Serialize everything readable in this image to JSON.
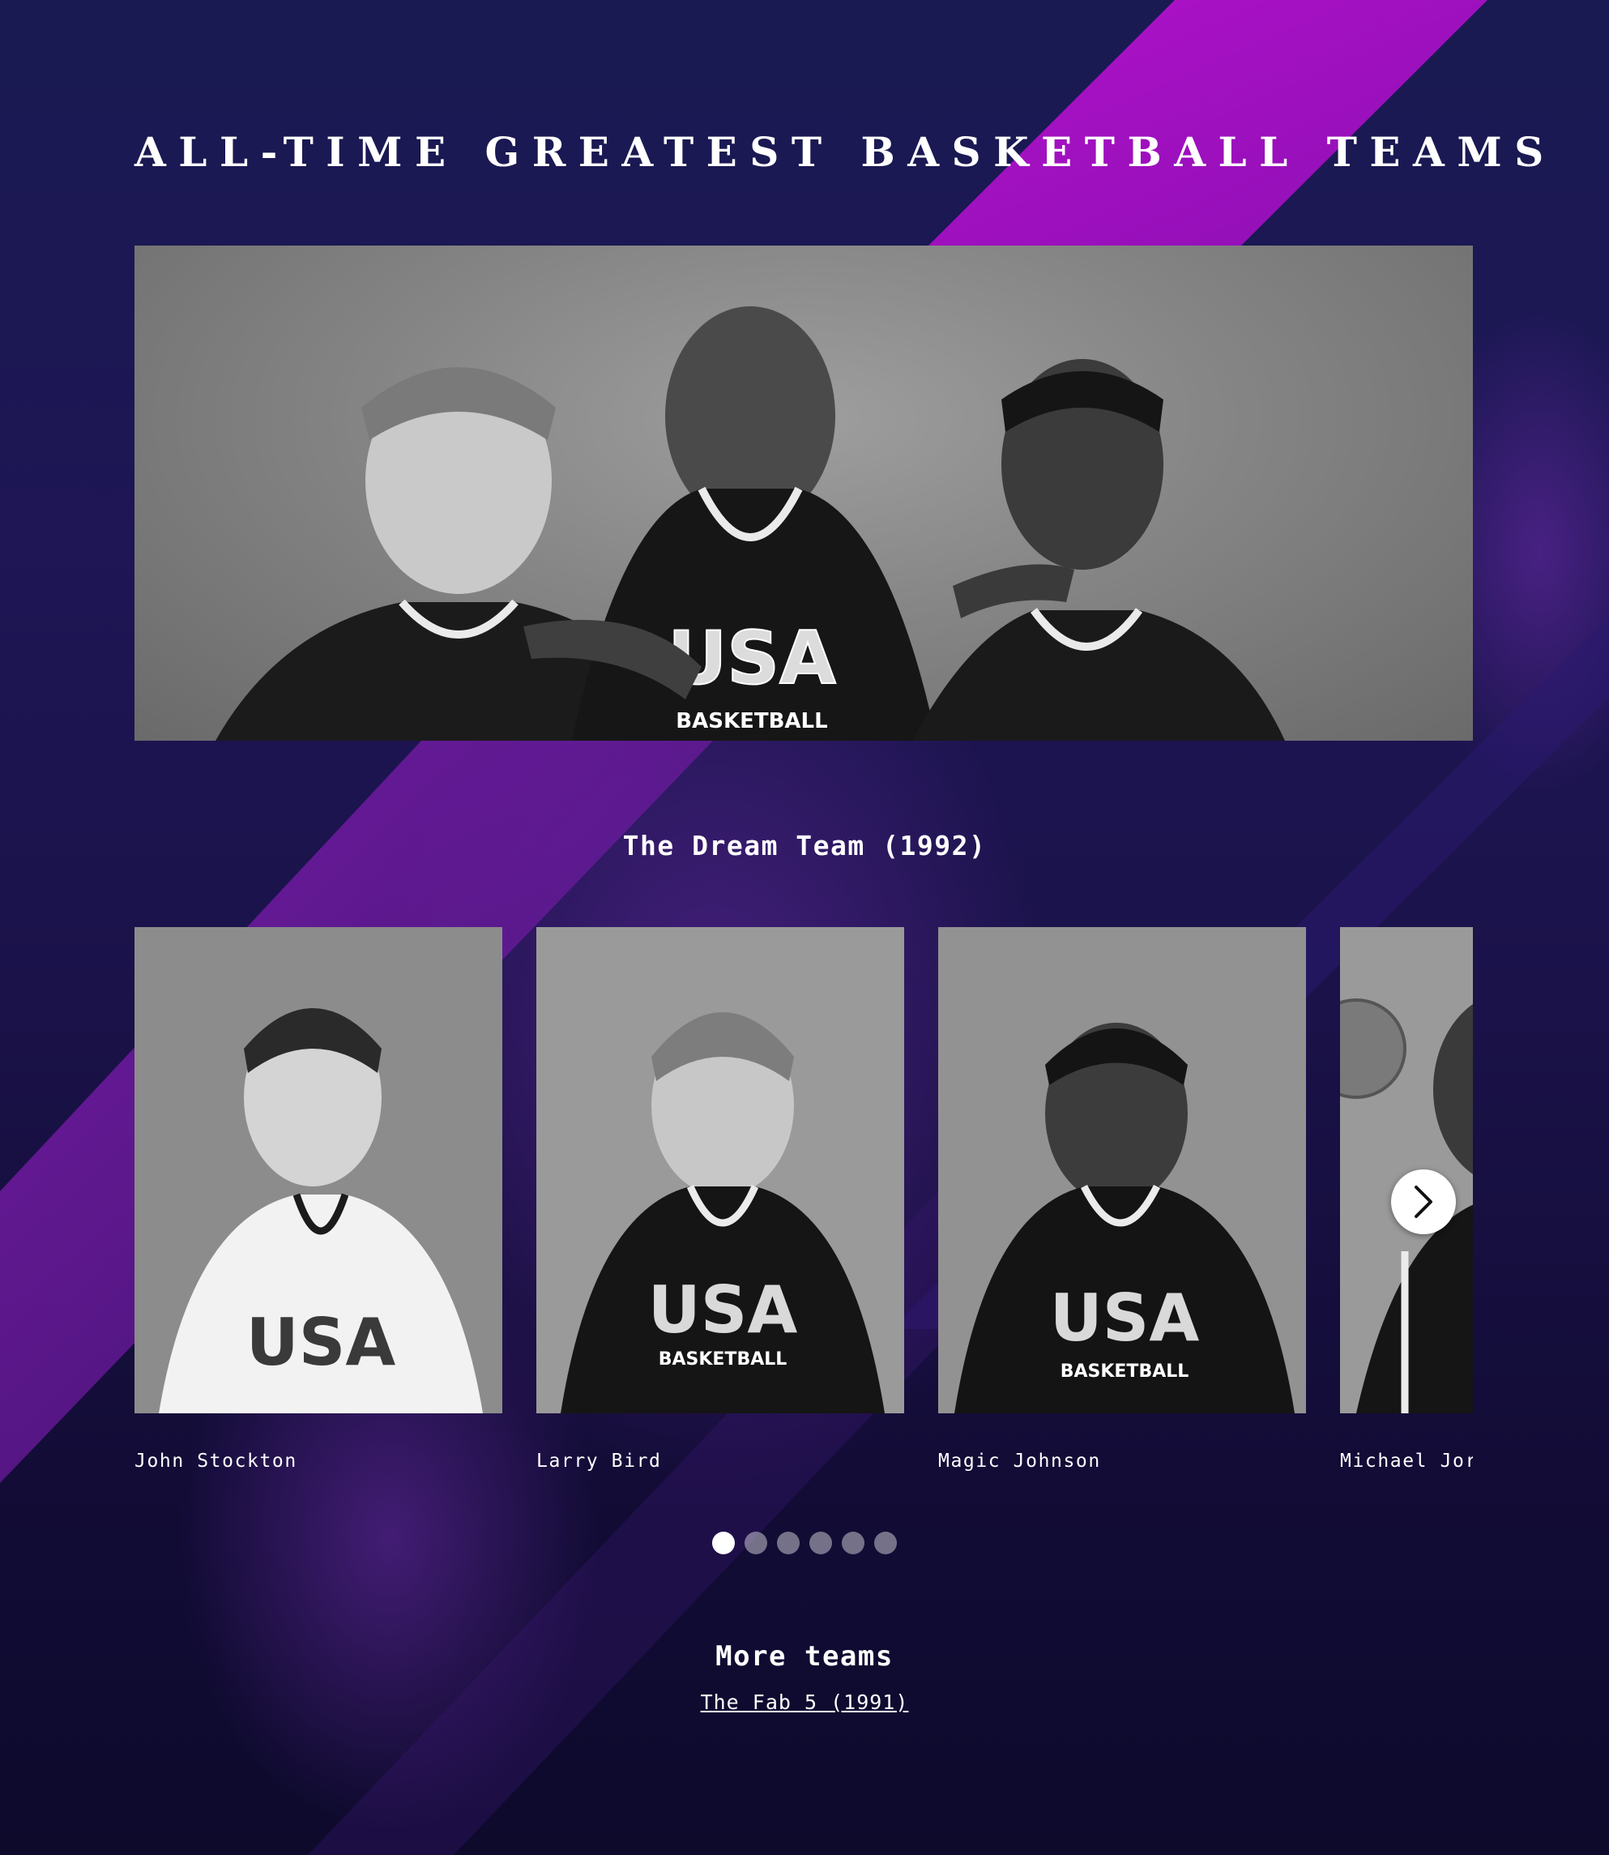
{
  "page": {
    "title": "ALL-TIME GREATEST BASKETBALL TEAMS"
  },
  "hero": {
    "image_alt": "Black and white photo of three players in USA Basketball jerseys",
    "jersey_text": "USA",
    "jersey_subtext": "BASKETBALL"
  },
  "team": {
    "name": "The Dream Team (1992)"
  },
  "carousel": {
    "cards": [
      {
        "name": "John Stockton",
        "jersey": "light"
      },
      {
        "name": "Larry Bird",
        "jersey": "dark"
      },
      {
        "name": "Magic Johnson",
        "jersey": "dark"
      },
      {
        "name": "Michael Jordan",
        "jersey": "dark"
      }
    ],
    "next_icon": "chevron-right-icon",
    "page_count": 6,
    "active_page": 1
  },
  "more": {
    "title": "More teams",
    "links": [
      "The Fab 5 (1991)"
    ]
  },
  "colors": {
    "background_top": "#191a52",
    "background_bottom": "#0d0a2c",
    "accent_magenta": "#a20fbf",
    "accent_purple": "#5b1a8c",
    "text": "#ffffff"
  }
}
